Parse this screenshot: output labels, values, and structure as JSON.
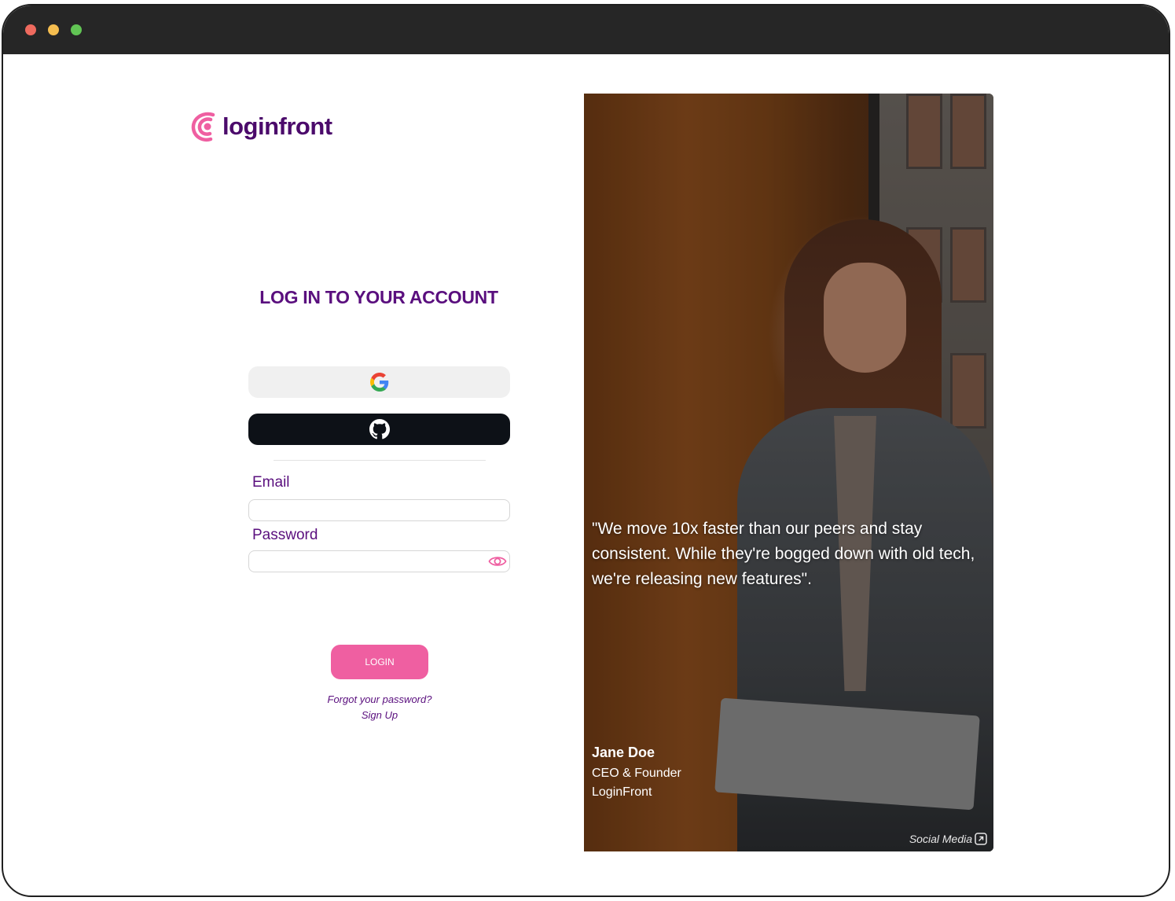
{
  "brand": {
    "name": "loginfront",
    "colors": {
      "primary": "#5a0f7e",
      "accent": "#ef5fa1"
    }
  },
  "login": {
    "heading": "LOG IN TO YOUR ACCOUNT",
    "google_icon": "google-icon",
    "github_icon": "github-icon",
    "email_label": "Email",
    "email_value": "",
    "password_label": "Password",
    "password_value": "",
    "submit_label": "LOGIN",
    "forgot_link": "Forgot your password?",
    "signup_link": "Sign Up"
  },
  "testimonial": {
    "quote": "\"We move 10x faster than our peers and stay consistent. While they're bogged down with old tech, we're releasing new features\".",
    "name": "Jane Doe",
    "role": "CEO & Founder",
    "company": "LoginFront",
    "social_link": "Social Media"
  }
}
